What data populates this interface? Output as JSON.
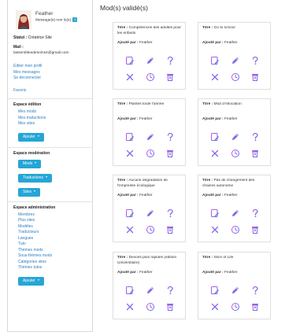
{
  "user": {
    "name": "Feather",
    "messages_text": "Message(s) non lu(s)",
    "messages_count": "0",
    "statut_label": "Statut :",
    "statut_value": "Créatrice Site",
    "mail_label": "Mail :",
    "mail_value": "lassembleedesrims4@gmail.com"
  },
  "account_links": [
    "Editer mon profil",
    "Mes messages",
    "Se déconnecter"
  ],
  "favoris": "Favoris",
  "espace_edition": {
    "title": "Espace édition",
    "links": [
      "Mes mods",
      "Mes traductions",
      "Mes sites"
    ],
    "button": "Ajouter"
  },
  "espace_moderation": {
    "title": "Espace modération",
    "buttons": [
      "Mods",
      "Traductions",
      "Sites"
    ]
  },
  "espace_administration": {
    "title": "Espace administration",
    "links": [
      "Membres",
      "Plus sites",
      "Modèles",
      "Traducteurs",
      "Langues",
      "Tuto",
      "Thèmes mods",
      "Sous-thèmes mods",
      "Catégories sites",
      "Thèmes tutos"
    ],
    "button": "Ajouter"
  },
  "main": {
    "title": "Mod(s) validé(s)",
    "title_label": "Titre :",
    "author_label": "Ajouté par :",
    "cards": [
      {
        "title": "Compétences des adultes pour les enfants",
        "author": "Feather"
      },
      {
        "title": "Go to school",
        "author": "Feather"
      },
      {
        "title": "Plantes toute l'année",
        "author": "Feather"
      },
      {
        "title": "Mod d'Allocation",
        "author": "Feather"
      },
      {
        "title": "Aucune dégradation de l'empreinte écologique",
        "author": "Feather"
      },
      {
        "title": "Pas de changement des chaines autonome",
        "author": "Feather"
      },
      {
        "title": "Devoirs plus rapides (édition Universitaire)",
        "author": "Feather"
      },
      {
        "title": "Slice of Life",
        "author": "Feather"
      }
    ]
  },
  "icons": [
    "edit-document-icon",
    "pencil-icon",
    "question-icon",
    "close-icon",
    "clock-icon",
    "trash-icon"
  ],
  "colors": {
    "accent": "#25a6d6",
    "link": "#2f7ec1",
    "icon_purple": "#a45ce0",
    "icon_blue": "#4f6ee6"
  }
}
